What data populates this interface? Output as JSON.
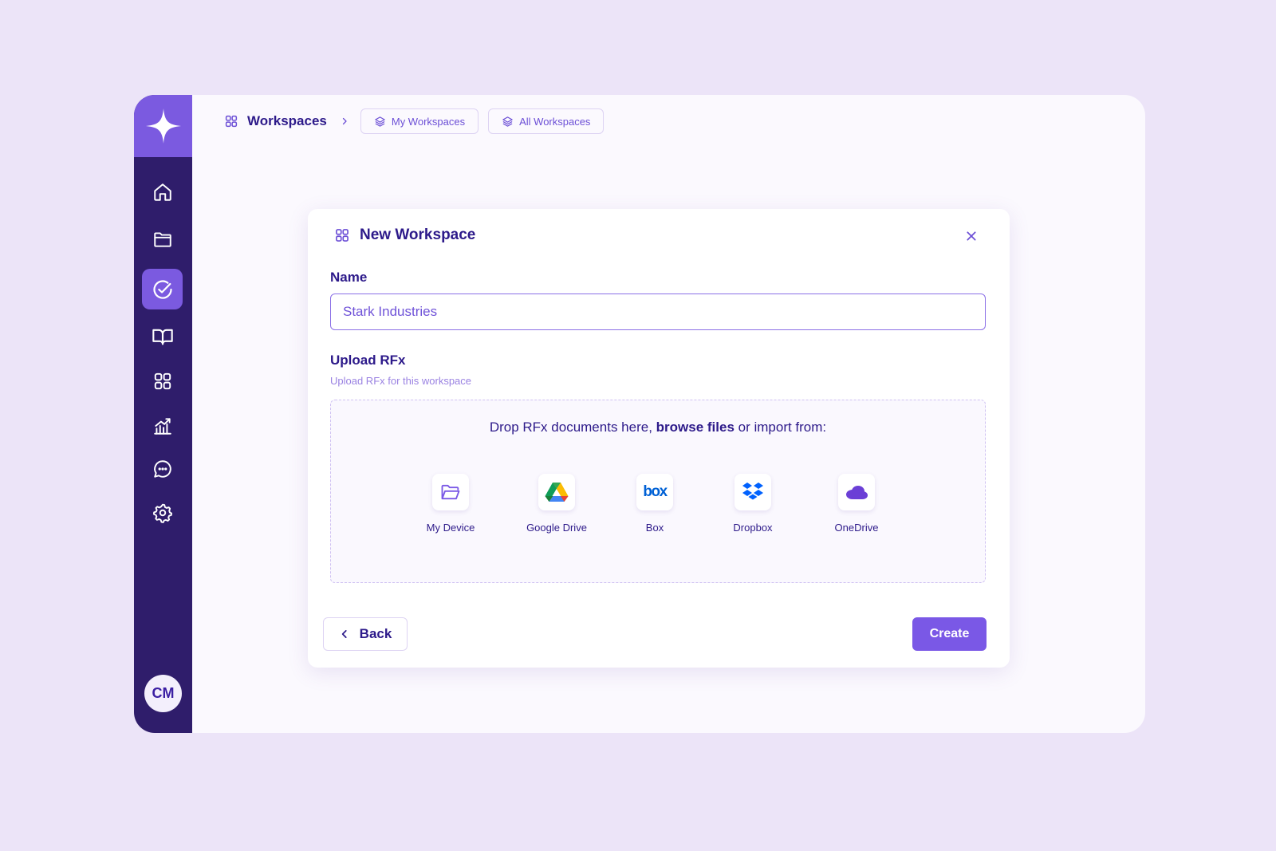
{
  "sidebar": {
    "logo": "sparkle-logo",
    "items": [
      {
        "icon": "home-icon",
        "active": false
      },
      {
        "icon": "folder-icon",
        "active": false
      },
      {
        "icon": "check-circle-icon",
        "active": true
      },
      {
        "icon": "book-icon",
        "active": false
      },
      {
        "icon": "grid-icon",
        "active": false
      },
      {
        "icon": "analytics-icon",
        "active": false
      },
      {
        "icon": "chat-icon",
        "active": false
      },
      {
        "icon": "gear-icon",
        "active": false
      }
    ],
    "avatar_initials": "CM"
  },
  "breadcrumb": {
    "root": "Workspaces",
    "chips": [
      "My Workspaces",
      "All Workspaces"
    ]
  },
  "modal": {
    "title": "New Workspace",
    "name_label": "Name",
    "name_value": "Stark Industries",
    "upload_label": "Upload RFx",
    "upload_sub": "Upload RFx for this workspace",
    "drop_text_before": "Drop RFx documents here, ",
    "drop_text_link": "browse files",
    "drop_text_after": " or import from:",
    "sources": [
      {
        "label": "My Device",
        "icon": "folder-open-icon"
      },
      {
        "label": "Google Drive",
        "icon": "google-drive-icon"
      },
      {
        "label": "Box",
        "icon": "box-icon"
      },
      {
        "label": "Dropbox",
        "icon": "dropbox-icon"
      },
      {
        "label": "OneDrive",
        "icon": "onedrive-icon"
      }
    ],
    "back_label": "Back",
    "create_label": "Create"
  },
  "colors": {
    "background": "#ece4f8",
    "sidebar": "#2f1d6b",
    "accent": "#7b5ae0",
    "text_primary": "#2d1a8a"
  }
}
